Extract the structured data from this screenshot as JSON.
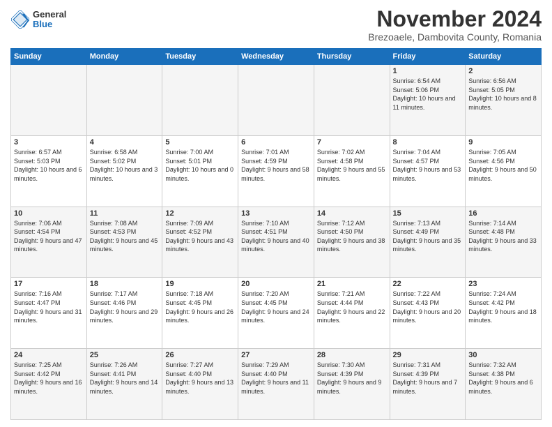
{
  "logo": {
    "general": "General",
    "blue": "Blue"
  },
  "header": {
    "month_title": "November 2024",
    "subtitle": "Brezoaele, Dambovita County, Romania"
  },
  "weekdays": [
    "Sunday",
    "Monday",
    "Tuesday",
    "Wednesday",
    "Thursday",
    "Friday",
    "Saturday"
  ],
  "weeks": [
    [
      {
        "day": "",
        "text": ""
      },
      {
        "day": "",
        "text": ""
      },
      {
        "day": "",
        "text": ""
      },
      {
        "day": "",
        "text": ""
      },
      {
        "day": "",
        "text": ""
      },
      {
        "day": "1",
        "text": "Sunrise: 6:54 AM\nSunset: 5:06 PM\nDaylight: 10 hours and 11 minutes."
      },
      {
        "day": "2",
        "text": "Sunrise: 6:56 AM\nSunset: 5:05 PM\nDaylight: 10 hours and 8 minutes."
      }
    ],
    [
      {
        "day": "3",
        "text": "Sunrise: 6:57 AM\nSunset: 5:03 PM\nDaylight: 10 hours and 6 minutes."
      },
      {
        "day": "4",
        "text": "Sunrise: 6:58 AM\nSunset: 5:02 PM\nDaylight: 10 hours and 3 minutes."
      },
      {
        "day": "5",
        "text": "Sunrise: 7:00 AM\nSunset: 5:01 PM\nDaylight: 10 hours and 0 minutes."
      },
      {
        "day": "6",
        "text": "Sunrise: 7:01 AM\nSunset: 4:59 PM\nDaylight: 9 hours and 58 minutes."
      },
      {
        "day": "7",
        "text": "Sunrise: 7:02 AM\nSunset: 4:58 PM\nDaylight: 9 hours and 55 minutes."
      },
      {
        "day": "8",
        "text": "Sunrise: 7:04 AM\nSunset: 4:57 PM\nDaylight: 9 hours and 53 minutes."
      },
      {
        "day": "9",
        "text": "Sunrise: 7:05 AM\nSunset: 4:56 PM\nDaylight: 9 hours and 50 minutes."
      }
    ],
    [
      {
        "day": "10",
        "text": "Sunrise: 7:06 AM\nSunset: 4:54 PM\nDaylight: 9 hours and 47 minutes."
      },
      {
        "day": "11",
        "text": "Sunrise: 7:08 AM\nSunset: 4:53 PM\nDaylight: 9 hours and 45 minutes."
      },
      {
        "day": "12",
        "text": "Sunrise: 7:09 AM\nSunset: 4:52 PM\nDaylight: 9 hours and 43 minutes."
      },
      {
        "day": "13",
        "text": "Sunrise: 7:10 AM\nSunset: 4:51 PM\nDaylight: 9 hours and 40 minutes."
      },
      {
        "day": "14",
        "text": "Sunrise: 7:12 AM\nSunset: 4:50 PM\nDaylight: 9 hours and 38 minutes."
      },
      {
        "day": "15",
        "text": "Sunrise: 7:13 AM\nSunset: 4:49 PM\nDaylight: 9 hours and 35 minutes."
      },
      {
        "day": "16",
        "text": "Sunrise: 7:14 AM\nSunset: 4:48 PM\nDaylight: 9 hours and 33 minutes."
      }
    ],
    [
      {
        "day": "17",
        "text": "Sunrise: 7:16 AM\nSunset: 4:47 PM\nDaylight: 9 hours and 31 minutes."
      },
      {
        "day": "18",
        "text": "Sunrise: 7:17 AM\nSunset: 4:46 PM\nDaylight: 9 hours and 29 minutes."
      },
      {
        "day": "19",
        "text": "Sunrise: 7:18 AM\nSunset: 4:45 PM\nDaylight: 9 hours and 26 minutes."
      },
      {
        "day": "20",
        "text": "Sunrise: 7:20 AM\nSunset: 4:45 PM\nDaylight: 9 hours and 24 minutes."
      },
      {
        "day": "21",
        "text": "Sunrise: 7:21 AM\nSunset: 4:44 PM\nDaylight: 9 hours and 22 minutes."
      },
      {
        "day": "22",
        "text": "Sunrise: 7:22 AM\nSunset: 4:43 PM\nDaylight: 9 hours and 20 minutes."
      },
      {
        "day": "23",
        "text": "Sunrise: 7:24 AM\nSunset: 4:42 PM\nDaylight: 9 hours and 18 minutes."
      }
    ],
    [
      {
        "day": "24",
        "text": "Sunrise: 7:25 AM\nSunset: 4:42 PM\nDaylight: 9 hours and 16 minutes."
      },
      {
        "day": "25",
        "text": "Sunrise: 7:26 AM\nSunset: 4:41 PM\nDaylight: 9 hours and 14 minutes."
      },
      {
        "day": "26",
        "text": "Sunrise: 7:27 AM\nSunset: 4:40 PM\nDaylight: 9 hours and 13 minutes."
      },
      {
        "day": "27",
        "text": "Sunrise: 7:29 AM\nSunset: 4:40 PM\nDaylight: 9 hours and 11 minutes."
      },
      {
        "day": "28",
        "text": "Sunrise: 7:30 AM\nSunset: 4:39 PM\nDaylight: 9 hours and 9 minutes."
      },
      {
        "day": "29",
        "text": "Sunrise: 7:31 AM\nSunset: 4:39 PM\nDaylight: 9 hours and 7 minutes."
      },
      {
        "day": "30",
        "text": "Sunrise: 7:32 AM\nSunset: 4:38 PM\nDaylight: 9 hours and 6 minutes."
      }
    ]
  ]
}
